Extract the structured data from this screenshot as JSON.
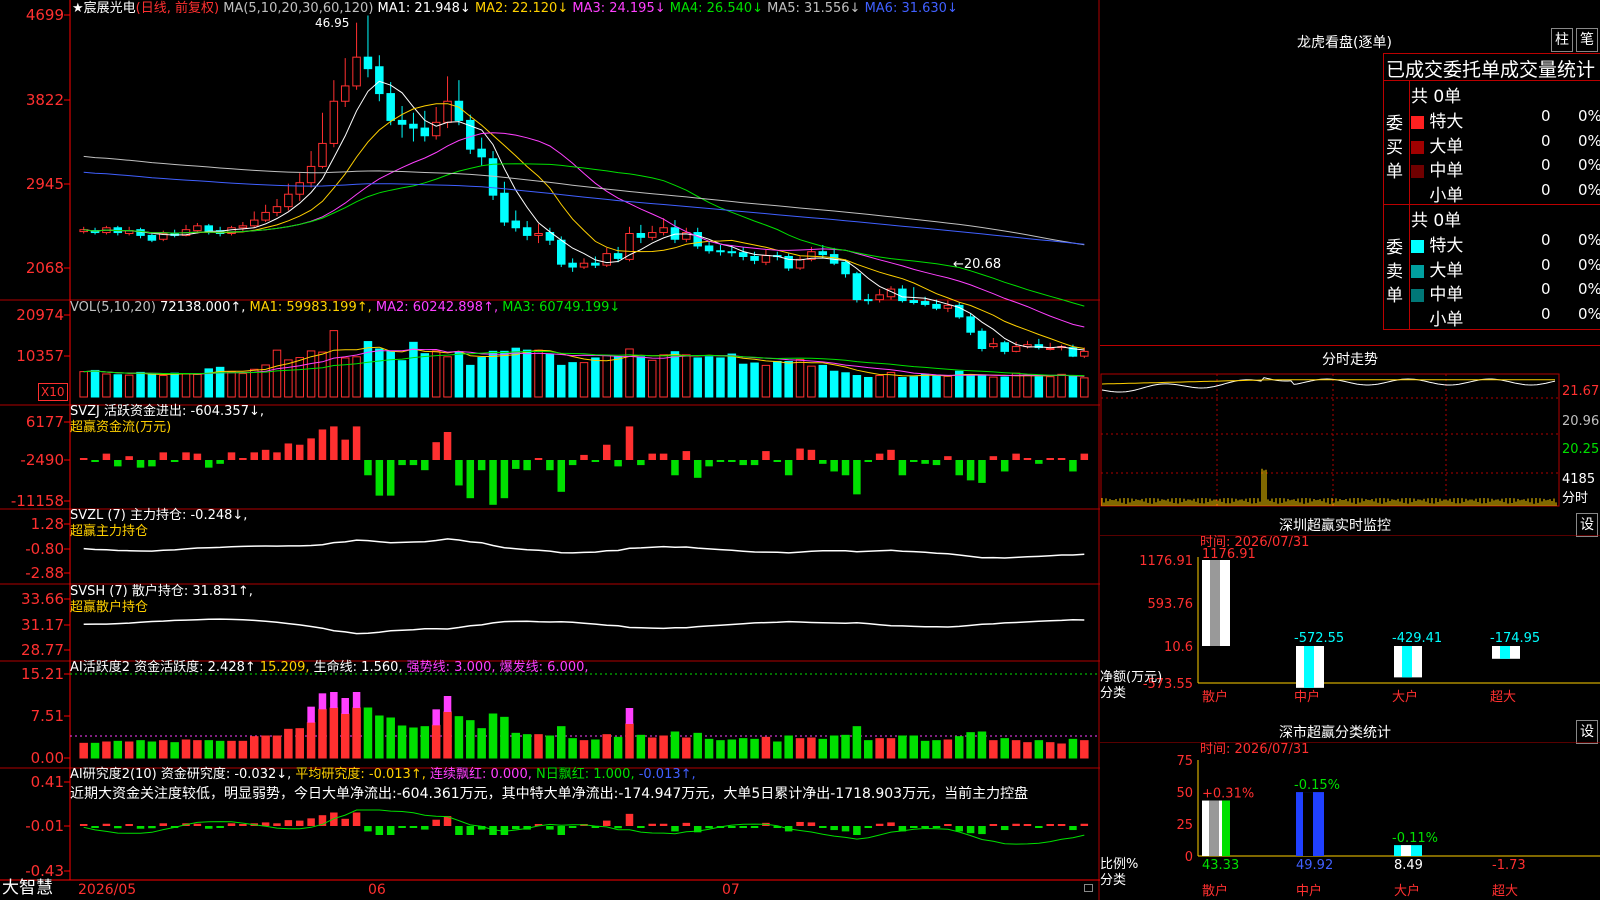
{
  "app_logo": "大智慧",
  "stock": {
    "name": "★宸展光电",
    "mode": "(日线, 前复权)"
  },
  "price_panel": {
    "ma_label": "MA(5,10,20,30,60,120)",
    "ma_values": [
      {
        "text": "MA1: 21.948↓",
        "color": "#ffffff"
      },
      {
        "text": "MA2: 22.120↓",
        "color": "#ffd000"
      },
      {
        "text": "MA3: 24.195↓",
        "color": "#ff40ff"
      },
      {
        "text": "MA4: 26.540↓",
        "color": "#00e000"
      },
      {
        "text": "MA5: 31.556↓",
        "color": "#c0c0c0"
      },
      {
        "text": "MA6: 31.630↓",
        "color": "#4060ff"
      }
    ],
    "y_ticks": [
      "4699",
      "3822",
      "2945",
      "2068"
    ],
    "high_label": "46.95",
    "low_label": "←20.68"
  },
  "volume_panel": {
    "label": "VOL(5,10,20)",
    "value": "72138.000↑,",
    "ma": [
      {
        "text": "MA1: 59983.199↑,",
        "color": "#ffd000"
      },
      {
        "text": "MA2: 60242.898↑,",
        "color": "#ff40ff"
      },
      {
        "text": "MA3: 60749.199↓",
        "color": "#00e000"
      }
    ],
    "y_ticks": [
      "20974",
      "10357"
    ],
    "unit": "X10"
  },
  "svzj_panel": {
    "label": "SVZJ  活跃资金进出: -604.357↓,",
    "sub": "超赢资金流(万元)",
    "y_ticks": [
      "6177",
      "-2490",
      "-11158"
    ]
  },
  "svzl_panel": {
    "label": "SVZL (7) 主力持仓: -0.248↓,",
    "sub": "超赢主力持仓",
    "y_ticks": [
      "1.28",
      "-0.80",
      "-2.88"
    ]
  },
  "svsh_panel": {
    "label": "SVSH (7) 散户持仓: 31.831↑,",
    "sub": "超赢散户持仓",
    "y_ticks": [
      "33.66",
      "31.17",
      "28.77"
    ]
  },
  "ai_active_panel": {
    "parts": [
      {
        "text": "AI活跃度2 资金活跃度: 2.428↑",
        "color": "#ffffff"
      },
      {
        "text": "15.209,",
        "color": "#ffd000"
      },
      {
        "text": "生命线: 1.560,",
        "color": "#ffffff"
      },
      {
        "text": "强势线: 3.000,",
        "color": "#ff40ff"
      },
      {
        "text": "爆发线: 6.000,",
        "color": "#ff40ff"
      }
    ],
    "y_ticks": [
      "15.21",
      "7.51",
      "0.00"
    ]
  },
  "ai_research_panel": {
    "parts": [
      {
        "text": "AI研究度2(10) 资金研究度: -0.032↓,",
        "color": "#ffffff"
      },
      {
        "text": "平均研究度: -0.013↑,",
        "color": "#ffd000"
      },
      {
        "text": "连续飘红: 0.000,",
        "color": "#ff40ff"
      },
      {
        "text": "N日飘红: 1.000,",
        "color": "#00e000"
      },
      {
        "text": "-0.013↑,",
        "color": "#4060ff"
      }
    ],
    "comment": "近期大资金关注度较低，明显弱势，今日大单净流出:-604.361万元，其中特大单净流出:-174.947万元，大单5日累计净出-1718.903万元，当前主力控盘",
    "y_ticks": [
      "0.41",
      "-0.01",
      "-0.43"
    ]
  },
  "x_axis": [
    "2026/05",
    "06",
    "07"
  ],
  "order_book": {
    "title": "龙虎看盘(逐单)",
    "btn1": "柱",
    "btn2": "笔",
    "subtitle": "已成交委托单成交量统计",
    "buy_label": "委买单",
    "sell_label": "委卖单",
    "buy_total": "共 0单",
    "sell_total": "共 0单",
    "buy_rows": [
      {
        "label": "特大",
        "count": "0",
        "pct": "0%",
        "color": "#ff2020"
      },
      {
        "label": "大单",
        "count": "0",
        "pct": "0%",
        "color": "#a00000"
      },
      {
        "label": "中单",
        "count": "0",
        "pct": "0%",
        "color": "#700000"
      },
      {
        "label": "小单",
        "count": "0",
        "pct": "0%",
        "color": ""
      }
    ],
    "sell_rows": [
      {
        "label": "特大",
        "count": "0",
        "pct": "0%",
        "color": "#00ffff"
      },
      {
        "label": "大单",
        "count": "0",
        "pct": "0%",
        "color": "#00a0a0"
      },
      {
        "label": "中单",
        "count": "0",
        "pct": "0%",
        "color": "#007878"
      },
      {
        "label": "小单",
        "count": "0",
        "pct": "0%",
        "color": ""
      }
    ]
  },
  "intraday": {
    "title": "分时走势",
    "y_ticks": [
      "21.67",
      "20.96",
      "20.25"
    ],
    "vol_tick": "4185",
    "vol_unit": "分时"
  },
  "sz_monitor": {
    "title": "深圳超赢实时监控",
    "settings": "设",
    "time": "时间: 2026/07/31",
    "y_ticks": [
      "1176.91",
      "593.76",
      "10.6",
      "-573.55"
    ],
    "y_label": "净额(万元)",
    "x_label": "分类",
    "categories": [
      "散户",
      "中户",
      "大户",
      "超大"
    ],
    "values": [
      1176.91,
      -572.55,
      -429.41,
      -174.95
    ],
    "value_labels": [
      "1176.91",
      "-572.55",
      "-429.41",
      "-174.95"
    ]
  },
  "sz_stats": {
    "title": "深市超赢分类统计",
    "settings": "设",
    "time": "时间: 2026/07/31",
    "y_ticks": [
      "75",
      "50",
      "25",
      "0"
    ],
    "y_label": "比例%",
    "x_label": "分类",
    "categories": [
      "散户",
      "中户",
      "大户",
      "超大"
    ],
    "bar_values": [
      43.33,
      49.92,
      8.49,
      1.73
    ],
    "bottom_labels": [
      "43.33",
      "49.92",
      "8.49",
      "-1.73"
    ],
    "change_labels": [
      "+0.31%",
      "-0.15%",
      "-0.11%",
      ""
    ],
    "colors": {
      "retail": "#ffffff",
      "mid": "#2040ff",
      "big": "#00ffff",
      "accent_green": "#00e000"
    }
  },
  "colors": {
    "up": "#ff3030",
    "down": "#00ffff",
    "grid": "#a00000",
    "axis": "#ff0000"
  },
  "chart_data": {
    "type": "candlestick",
    "title": "★宸展光电",
    "x_ticks": [
      "2026/05",
      "06",
      "07"
    ],
    "ylim": [
      20,
      48
    ],
    "candles": [
      [
        24.4,
        24.6,
        24.9,
        24.2
      ],
      [
        24.5,
        24.3,
        24.8,
        24.1
      ],
      [
        24.3,
        24.8,
        25.0,
        24.1
      ],
      [
        24.8,
        24.3,
        25.0,
        24.0
      ],
      [
        24.2,
        24.5,
        24.9,
        24.0
      ],
      [
        24.6,
        24.0,
        24.8,
        23.7
      ],
      [
        24.0,
        23.5,
        24.2,
        23.3
      ],
      [
        23.6,
        24.2,
        24.5,
        23.4
      ],
      [
        24.2,
        24.0,
        24.6,
        23.8
      ],
      [
        24.0,
        24.6,
        25.1,
        23.9
      ],
      [
        24.5,
        25.0,
        25.3,
        24.2
      ],
      [
        25.0,
        24.4,
        25.2,
        24.1
      ],
      [
        24.5,
        24.2,
        24.9,
        23.9
      ],
      [
        24.2,
        24.8,
        25.0,
        24.0
      ],
      [
        24.8,
        25.0,
        25.4,
        24.4
      ],
      [
        25.0,
        25.6,
        26.5,
        24.8
      ],
      [
        25.6,
        26.4,
        27.2,
        25.4
      ],
      [
        26.4,
        27.0,
        27.8,
        26.0
      ],
      [
        27.0,
        28.3,
        29.4,
        26.6
      ],
      [
        28.3,
        29.5,
        30.5,
        27.6
      ],
      [
        29.5,
        31.2,
        32.8,
        29.0
      ],
      [
        31.2,
        33.6,
        36.8,
        31.0
      ],
      [
        33.6,
        38.0,
        40.2,
        33.2
      ],
      [
        38.0,
        39.6,
        42.5,
        37.4
      ],
      [
        39.6,
        42.6,
        46.2,
        39.2
      ],
      [
        42.6,
        41.4,
        46.95,
        40.5
      ],
      [
        41.6,
        38.8,
        42.8,
        38.0
      ],
      [
        38.8,
        36.0,
        40.0,
        35.5
      ],
      [
        36.0,
        35.6,
        37.5,
        34.2
      ],
      [
        35.6,
        35.2,
        36.8,
        33.8
      ],
      [
        35.2,
        34.4,
        37.0,
        33.8
      ],
      [
        34.4,
        35.8,
        37.4,
        34.0
      ],
      [
        35.8,
        38.0,
        40.6,
        35.2
      ],
      [
        38.0,
        36.0,
        40.2,
        35.5
      ],
      [
        36.0,
        33.0,
        36.6,
        32.5
      ],
      [
        33.0,
        32.2,
        34.2,
        31.3
      ],
      [
        32.0,
        28.2,
        32.8,
        27.7
      ],
      [
        28.4,
        25.4,
        29.6,
        25.0
      ],
      [
        25.5,
        24.8,
        26.6,
        24.4
      ],
      [
        24.8,
        24.0,
        25.5,
        23.5
      ],
      [
        24.0,
        24.2,
        25.2,
        23.2
      ],
      [
        24.3,
        23.5,
        24.8,
        23.0
      ],
      [
        23.5,
        21.0,
        23.9,
        20.7
      ],
      [
        21.1,
        20.7,
        21.6,
        20.2
      ],
      [
        20.7,
        21.1,
        21.6,
        20.5
      ],
      [
        21.1,
        20.9,
        21.8,
        20.6
      ],
      [
        20.9,
        22.1,
        22.7,
        20.7
      ],
      [
        22.1,
        21.6,
        22.8,
        21.2
      ],
      [
        21.5,
        24.2,
        24.9,
        21.3
      ],
      [
        24.2,
        23.8,
        25.1,
        23.2
      ],
      [
        23.8,
        24.3,
        25.0,
        23.5
      ],
      [
        24.3,
        24.8,
        25.8,
        24.0
      ],
      [
        24.8,
        23.6,
        25.6,
        23.2
      ],
      [
        23.6,
        24.3,
        24.8,
        23.3
      ],
      [
        24.3,
        22.9,
        24.8,
        22.6
      ],
      [
        22.9,
        22.4,
        23.4,
        22.1
      ],
      [
        22.4,
        22.3,
        23.0,
        21.9
      ],
      [
        22.3,
        22.2,
        23.0,
        21.8
      ],
      [
        22.2,
        21.8,
        22.8,
        21.4
      ],
      [
        21.8,
        21.4,
        22.3,
        21.0
      ],
      [
        21.2,
        21.9,
        22.5,
        20.9
      ],
      [
        21.9,
        21.8,
        22.3,
        21.4
      ],
      [
        21.8,
        20.6,
        22.1,
        20.3
      ],
      [
        20.6,
        21.5,
        21.8,
        20.4
      ],
      [
        21.5,
        22.3,
        22.8,
        21.3
      ],
      [
        22.3,
        22.0,
        23.0,
        21.7
      ],
      [
        22.0,
        21.1,
        22.7,
        20.9
      ],
      [
        21.2,
        20.0,
        21.5,
        19.6
      ],
      [
        20.0,
        17.3,
        20.2,
        17.0
      ],
      [
        17.3,
        17.2,
        17.9,
        16.8
      ],
      [
        17.3,
        17.8,
        18.4,
        17.0
      ],
      [
        17.6,
        18.4,
        18.7,
        17.3
      ],
      [
        18.4,
        17.2,
        18.8,
        17.0
      ],
      [
        17.2,
        17.0,
        18.6,
        16.8
      ],
      [
        17.1,
        16.8,
        17.6,
        16.6
      ],
      [
        16.8,
        16.4,
        17.3,
        16.2
      ],
      [
        16.4,
        16.7,
        17.2,
        16.0
      ],
      [
        16.7,
        15.5,
        17.0,
        15.3
      ],
      [
        15.5,
        13.9,
        15.9,
        13.6
      ],
      [
        14.0,
        12.2,
        14.3,
        11.9
      ],
      [
        12.4,
        12.7,
        13.3,
        12.2
      ],
      [
        12.8,
        11.9,
        13.0,
        11.6
      ],
      [
        11.9,
        12.4,
        12.9,
        11.8
      ],
      [
        12.4,
        12.6,
        13.0,
        12.2
      ],
      [
        12.6,
        12.3,
        13.2,
        12.1
      ],
      [
        12.2,
        12.2,
        12.8,
        12.0
      ],
      [
        12.3,
        12.4,
        12.6,
        12.0
      ],
      [
        12.3,
        11.4,
        12.6,
        11.3
      ],
      [
        11.4,
        11.9,
        12.3,
        11.2
      ]
    ],
    "volume": [
      6500,
      6800,
      5900,
      5700,
      5600,
      6300,
      5800,
      5500,
      6100,
      6000,
      5800,
      7200,
      7600,
      6400,
      6000,
      7100,
      8200,
      12000,
      9500,
      10100,
      11800,
      11500,
      17000,
      10000,
      10300,
      14200,
      12300,
      11700,
      9300,
      14000,
      11100,
      11800,
      10300,
      11600,
      8100,
      10100,
      11700,
      11700,
      12500,
      12000,
      12000,
      11000,
      8100,
      8800,
      8800,
      10000,
      10600,
      10300,
      12300,
      10300,
      9400,
      10800,
      11600,
      10800,
      10000,
      10300,
      10000,
      11000,
      8400,
      8700,
      8100,
      9100,
      9100,
      9600,
      7900,
      8100,
      6600,
      6200,
      5500,
      5000,
      5500,
      6300,
      5000,
      5200,
      5800,
      5600,
      5300,
      6600,
      5600,
      5400,
      5100,
      5100,
      6100,
      5600,
      5200,
      5200,
      5800,
      5500,
      4900,
      4600,
      5400,
      7000,
      5100,
      5200,
      5700,
      6100
    ],
    "ma_series": [
      {
        "name": "MA1",
        "color": "#ffffff"
      },
      {
        "name": "MA2",
        "color": "#ffd000"
      },
      {
        "name": "MA3",
        "color": "#ff40ff"
      },
      {
        "name": "MA4",
        "color": "#00e000"
      },
      {
        "name": "MA5",
        "color": "#c0c0c0"
      },
      {
        "name": "MA6",
        "color": "#4060ff"
      }
    ]
  }
}
